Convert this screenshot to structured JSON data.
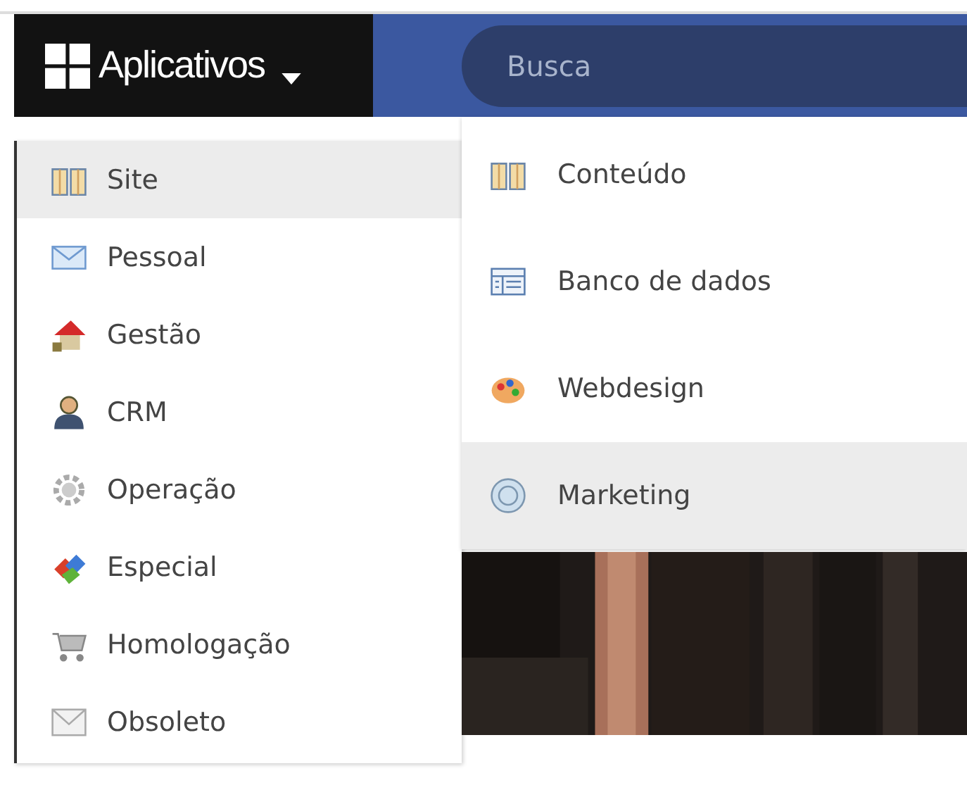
{
  "apps_button": {
    "label": "Aplicativos"
  },
  "search": {
    "placeholder": "Busca"
  },
  "menu": {
    "items": [
      {
        "label": "Site",
        "selected": true
      },
      {
        "label": "Pessoal",
        "selected": false
      },
      {
        "label": "Gestão",
        "selected": false
      },
      {
        "label": "CRM",
        "selected": false
      },
      {
        "label": "Operação",
        "selected": false
      },
      {
        "label": "Especial",
        "selected": false
      },
      {
        "label": "Homologação",
        "selected": false
      },
      {
        "label": "Obsoleto",
        "selected": false
      }
    ]
  },
  "submenu": {
    "items": [
      {
        "label": "Conteúdo",
        "selected": false
      },
      {
        "label": "Banco de dados",
        "selected": false
      },
      {
        "label": "Webdesign",
        "selected": false
      },
      {
        "label": "Marketing",
        "selected": true
      }
    ]
  }
}
